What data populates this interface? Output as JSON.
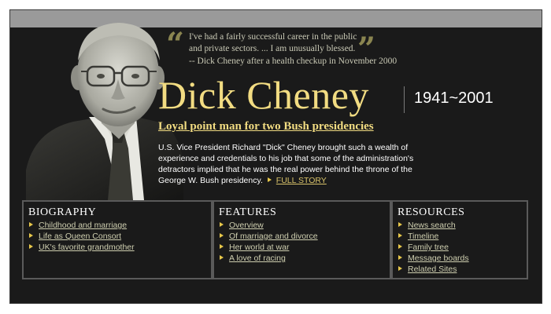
{
  "colors": {
    "background": "#1a1a1a",
    "top_bar": "#9a9a9a",
    "name_gold": "#f2dc82",
    "arrow_gold": "#e8c84a",
    "panel_border": "#5a5a5a"
  },
  "quote": {
    "open_mark": "“",
    "close_mark": "”",
    "text": "I've had a fairly successful career in the public and private sectors. ... I am unusually blessed.",
    "attribution": "-- Dick Cheney after a health checkup in November 2000"
  },
  "profile": {
    "name": "Dick Cheney",
    "years": "1941~2001",
    "subtitle": "Loyal point man for two Bush presidencies",
    "summary": "U.S. Vice President Richard \"Dick\" Cheney brought such a wealth of experience and credentials to his job that some of the administration's detractors implied that he was the real power behind the throne of the George W. Bush presidency.",
    "full_story_label": "FULL STORY"
  },
  "sections": {
    "biography": {
      "title": "BIOGRAPHY",
      "links": [
        "Childhood and marriage",
        "Life as Queen Consort",
        "UK's favorite grandmother"
      ]
    },
    "features": {
      "title": "FEATURES",
      "links": [
        "Overview",
        "Of marriage and divorce",
        "Her world at war",
        "A love of racing"
      ]
    },
    "resources": {
      "title": "RESOURCES",
      "links": [
        "News search",
        "Timeline",
        "Family tree",
        "Message boards",
        "Related Sites"
      ]
    }
  }
}
